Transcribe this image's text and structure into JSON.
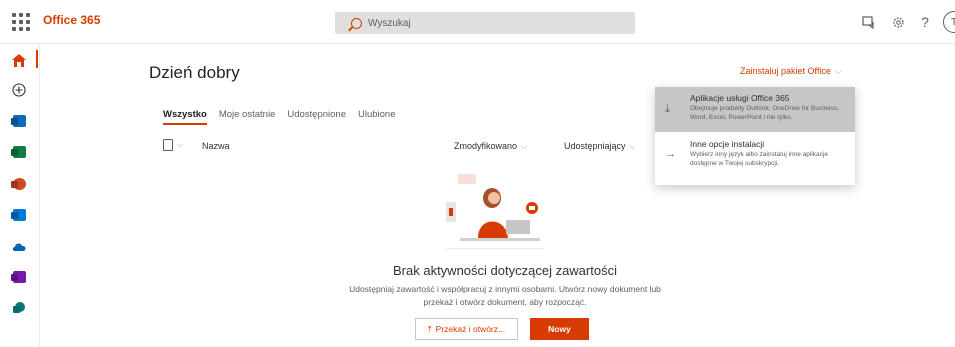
{
  "topbar": {
    "brand": "Office 365",
    "search_placeholder": "Wyszukaj",
    "help_glyph": "?",
    "avatar_initial": "T"
  },
  "rail": {
    "items": [
      {
        "name": "home",
        "color": "#d83b01"
      },
      {
        "name": "create"
      },
      {
        "name": "outlook",
        "color": "#0f6cbd"
      },
      {
        "name": "excel",
        "color": "#107c41"
      },
      {
        "name": "powerpoint",
        "color": "#d24726"
      },
      {
        "name": "outlook-alt",
        "color": "#0078d4"
      },
      {
        "name": "onedrive",
        "color": "#0364b8"
      },
      {
        "name": "onenote",
        "color": "#7719aa"
      },
      {
        "name": "sharepoint",
        "color": "#03787c"
      }
    ]
  },
  "main": {
    "greeting": "Dzień dobry",
    "install_label": "Zainstaluj pakiet Office",
    "tabs": [
      {
        "label": "Wszystko",
        "active": true
      },
      {
        "label": "Moje ostatnie"
      },
      {
        "label": "Udostępnione"
      },
      {
        "label": "Ulubione"
      }
    ],
    "columns": {
      "name": "Nazwa",
      "modified": "Zmodyfikowano",
      "shared_by": "Udostępniający"
    },
    "empty": {
      "title": "Brak aktywności dotyczącej zawartości",
      "desc_line1": "Udostępniaj zawartość i współpracuj z innymi osobami. Utwórz nowy dokument lub",
      "desc_line2": "przekaż i otwórz dokument, aby rozpocząć."
    },
    "upload_label": "Przekaż i otwórz...",
    "new_label": "Nowy"
  },
  "dropdown": {
    "items": [
      {
        "title": "Aplikacje usługi Office 365",
        "desc": "Obejmuje produkty Outlook, OneDrive for Business, Word, Excel, PowerPoint i nie tylko.",
        "icon": "download-icon"
      },
      {
        "title": "Inne opcje instalacji",
        "desc": "Wybierz inny język albo zainstaluj inne aplikacje dostępne w Twojej subskrypcji.",
        "icon": "arrow-right-icon"
      }
    ]
  },
  "colors": {
    "accent": "#d83b01"
  }
}
